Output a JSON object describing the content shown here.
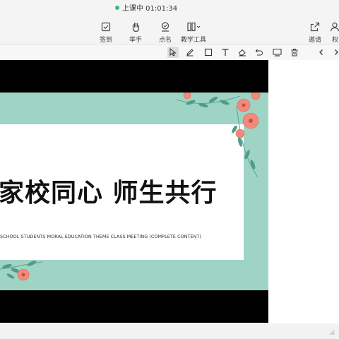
{
  "status": {
    "text": "上课中 01:01:34",
    "dot_color": "#2fbf71"
  },
  "toolbar": {
    "items": [
      {
        "label": "签到",
        "icon": "check-in-icon"
      },
      {
        "label": "举手",
        "icon": "raise-hand-icon"
      },
      {
        "label": "点名",
        "icon": "roll-call-icon"
      },
      {
        "label": "教学工具",
        "icon": "teaching-tools-icon"
      },
      {
        "label": "邀请",
        "icon": "invite-icon"
      },
      {
        "label": "权",
        "icon": "permission-icon"
      }
    ]
  },
  "drawing_tools": [
    "select-icon",
    "pen-icon",
    "rectangle-icon",
    "text-icon",
    "eraser-icon",
    "undo-icon",
    "screen-icon",
    "delete-icon",
    "prev-page-icon",
    "next-page-icon"
  ],
  "slide": {
    "title": "家校同心 师生共行",
    "subtitle": "SCHOOL STUDENTS MORAL EDUCATION THEME CLASS MEETING (COMPLETE CONTENT)",
    "background_color": "#9fd4c4",
    "flower_color": "#f08a7a"
  }
}
